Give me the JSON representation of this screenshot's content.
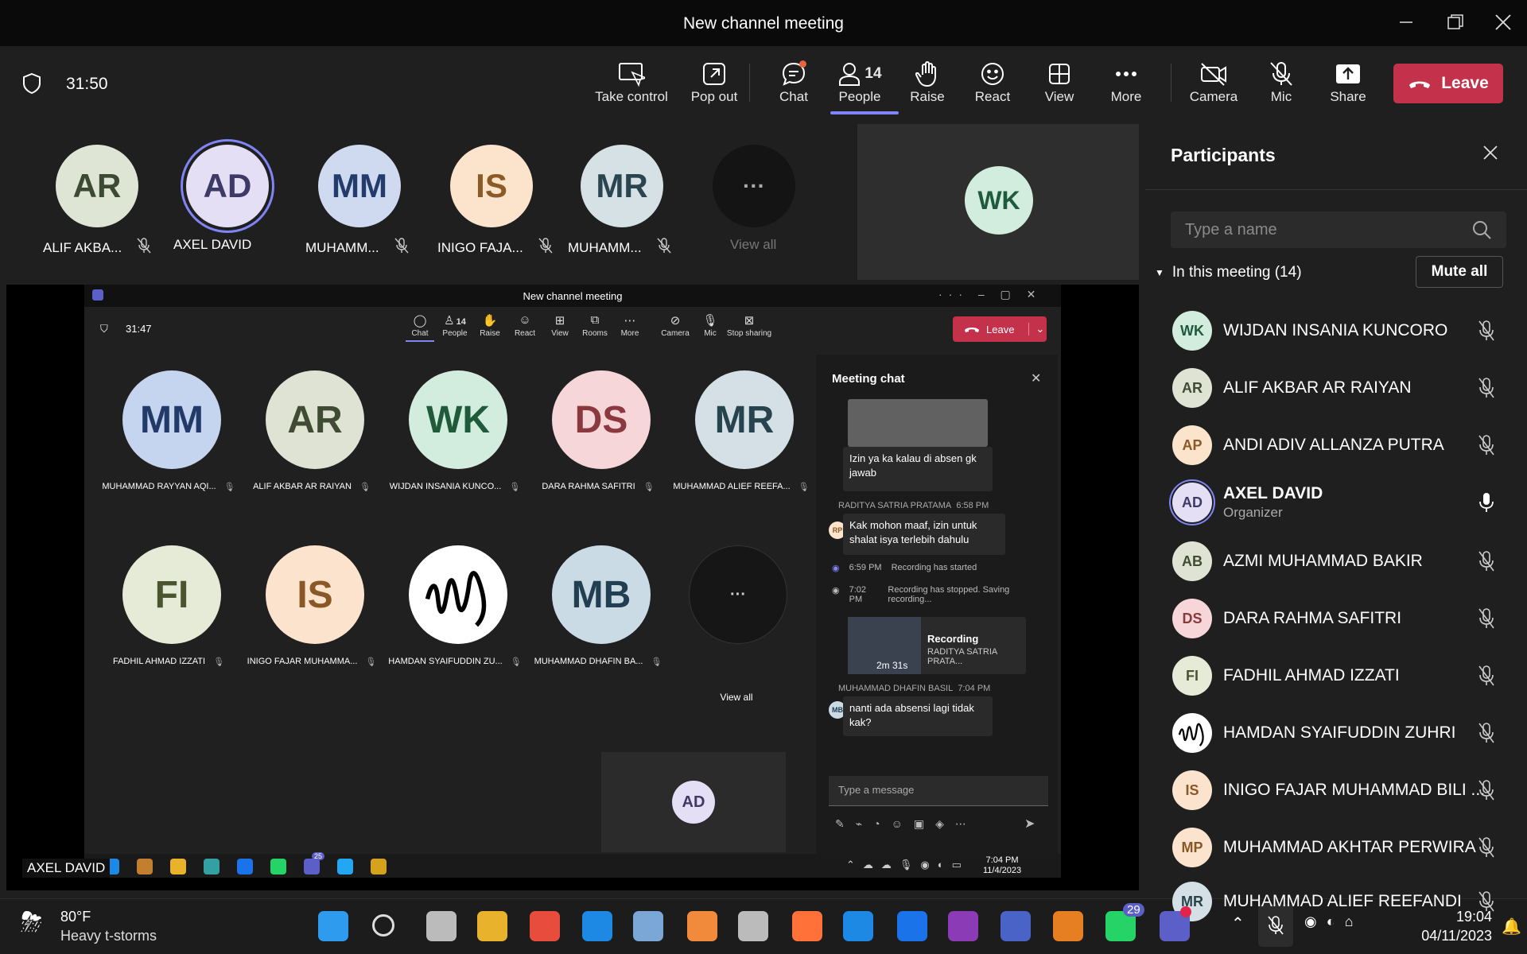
{
  "window": {
    "title": "New channel meeting"
  },
  "toolbar": {
    "timer": "31:50",
    "take_control": "Take control",
    "pop_out": "Pop out",
    "chat": "Chat",
    "people": "People",
    "people_count": "14",
    "raise": "Raise",
    "react": "React",
    "view": "View",
    "more": "More",
    "camera": "Camera",
    "mic": "Mic",
    "share": "Share",
    "leave": "Leave"
  },
  "strip": {
    "items": [
      {
        "initials": "AR",
        "name": "ALIF AKBA...",
        "bg": "#dfe5d5",
        "fg": "#3d4a33"
      },
      {
        "initials": "AD",
        "name": "AXEL DAVID",
        "bg": "#e4dff5",
        "fg": "#3d3a66"
      },
      {
        "initials": "MM",
        "name": "MUHAMM...",
        "bg": "#cfd9ef",
        "fg": "#233c6c"
      },
      {
        "initials": "IS",
        "name": "INIGO FAJA...",
        "bg": "#fbe3cc",
        "fg": "#8a5a27"
      },
      {
        "initials": "MR",
        "name": "MUHAMM...",
        "bg": "#d6e1e6",
        "fg": "#2b4550"
      }
    ],
    "view_all": "View all",
    "self_initials": "WK"
  },
  "shared": {
    "title": "New channel meeting",
    "timer": "31:47",
    "toolbar": {
      "chat": "Chat",
      "people": "People",
      "people_count": "14",
      "raise": "Raise",
      "react": "React",
      "view": "View",
      "rooms": "Rooms",
      "more": "More",
      "camera": "Camera",
      "mic": "Mic",
      "stop": "Stop sharing",
      "leave": "Leave"
    },
    "grid": [
      {
        "initials": "MM",
        "name": "MUHAMMAD RAYYAN AQI...",
        "bg": "#c5d4ef",
        "fg": "#213a6a"
      },
      {
        "initials": "AR",
        "name": "ALIF AKBAR AR RAIYAN",
        "bg": "#dfe3d3",
        "fg": "#404b34"
      },
      {
        "initials": "WK",
        "name": "WIJDAN INSANIA KUNCO...",
        "bg": "#d2ecde",
        "fg": "#1f5a3b"
      },
      {
        "initials": "DS",
        "name": "DARA RAHMA SAFITRI",
        "bg": "#f6d6d8",
        "fg": "#8a3a3f"
      },
      {
        "initials": "MR",
        "name": "MUHAMMAD ALIEF REEFA...",
        "bg": "#d4e0e6",
        "fg": "#27434e"
      },
      {
        "initials": "FI",
        "name": "FADHIL AHMAD IZZATI",
        "bg": "#e6ebd7",
        "fg": "#4a5530"
      },
      {
        "initials": "IS",
        "name": "INIGO FAJAR MUHAMMA...",
        "bg": "#fce3cd",
        "fg": "#8a5726"
      },
      {
        "initials": "",
        "name": "HAMDAN SYAIFUDDIN ZU...",
        "bg": "#ffffff",
        "fg": "#000000"
      },
      {
        "initials": "MB",
        "name": "MUHAMMAD DHAFIN BA...",
        "bg": "#cbdbe6",
        "fg": "#223f52"
      }
    ],
    "view_all": "View all",
    "self_initials": "AD",
    "chat": {
      "title": "Meeting chat",
      "msg1": "Izin ya ka kalau di absen gk jawab",
      "sender2": "RADITYA SATRIA PRATAMA",
      "time2": "6:58 PM",
      "initials2": "RP",
      "msg2": "Kak mohon maaf, izin untuk shalat isya terlebih dahulu",
      "event1_time": "6:59 PM",
      "event1": "Recording has started",
      "event2_time": "7:02 PM",
      "event2": "Recording has stopped. Saving recording...",
      "rec_title": "Recording",
      "rec_by": "RADITYA SATRIA PRATA...",
      "rec_dur": "2m 31s",
      "sender3": "MUHAMMAD DHAFIN BASIL",
      "time3": "7:04 PM",
      "initials3": "MB",
      "msg3": "nanti ada absensi lagi tidak kak?",
      "placeholder": "Type a message"
    },
    "presenter": "AXEL DAVID",
    "taskbar": {
      "time": "7:04 PM",
      "date": "11/4/2023",
      "badge": "25"
    }
  },
  "panel": {
    "title": "Participants",
    "search_placeholder": "Type a name",
    "section": "In this meeting (14)",
    "mute_all": "Mute all",
    "people": [
      {
        "initials": "WK",
        "name": "WIJDAN INSANIA KUNCORO",
        "role": "",
        "bg": "#d2ecde",
        "fg": "#1f5a3b"
      },
      {
        "initials": "AR",
        "name": "ALIF AKBAR AR RAIYAN",
        "role": "",
        "bg": "#dfe3d3",
        "fg": "#404b34"
      },
      {
        "initials": "AP",
        "name": "ANDI ADIV ALLANZA PUTRA",
        "role": "",
        "bg": "#fbe3cc",
        "fg": "#8a5a27"
      },
      {
        "initials": "AD",
        "name": "AXEL DAVID",
        "role": "Organizer",
        "bg": "#e4dff5",
        "fg": "#3d3a66"
      },
      {
        "initials": "AB",
        "name": "AZMI MUHAMMAD BAKIR",
        "role": "",
        "bg": "#dfe3d3",
        "fg": "#404b34"
      },
      {
        "initials": "DS",
        "name": "DARA RAHMA SAFITRI",
        "role": "",
        "bg": "#f6d6d8",
        "fg": "#8a3a3f"
      },
      {
        "initials": "FI",
        "name": "FADHIL AHMAD IZZATI",
        "role": "",
        "bg": "#e6ebd7",
        "fg": "#4a5530"
      },
      {
        "initials": "",
        "name": "HAMDAN SYAIFUDDIN ZUHRI",
        "role": "",
        "bg": "#ffffff",
        "fg": "#000000"
      },
      {
        "initials": "IS",
        "name": "INIGO FAJAR MUHAMMAD BILI ...",
        "role": "",
        "bg": "#fce3cd",
        "fg": "#8a5726"
      },
      {
        "initials": "MP",
        "name": "MUHAMMAD AKHTAR PERWIRA",
        "role": "",
        "bg": "#fce3cd",
        "fg": "#8a5726"
      },
      {
        "initials": "MR",
        "name": "MUHAMMAD ALIEF REEFANDI",
        "role": "",
        "bg": "#d4e0e6",
        "fg": "#27434e"
      }
    ]
  },
  "taskbar": {
    "temp": "80°F",
    "weather": "Heavy t-storms",
    "time": "19:04",
    "date": "04/11/2023",
    "whatsapp_badge": "29"
  }
}
